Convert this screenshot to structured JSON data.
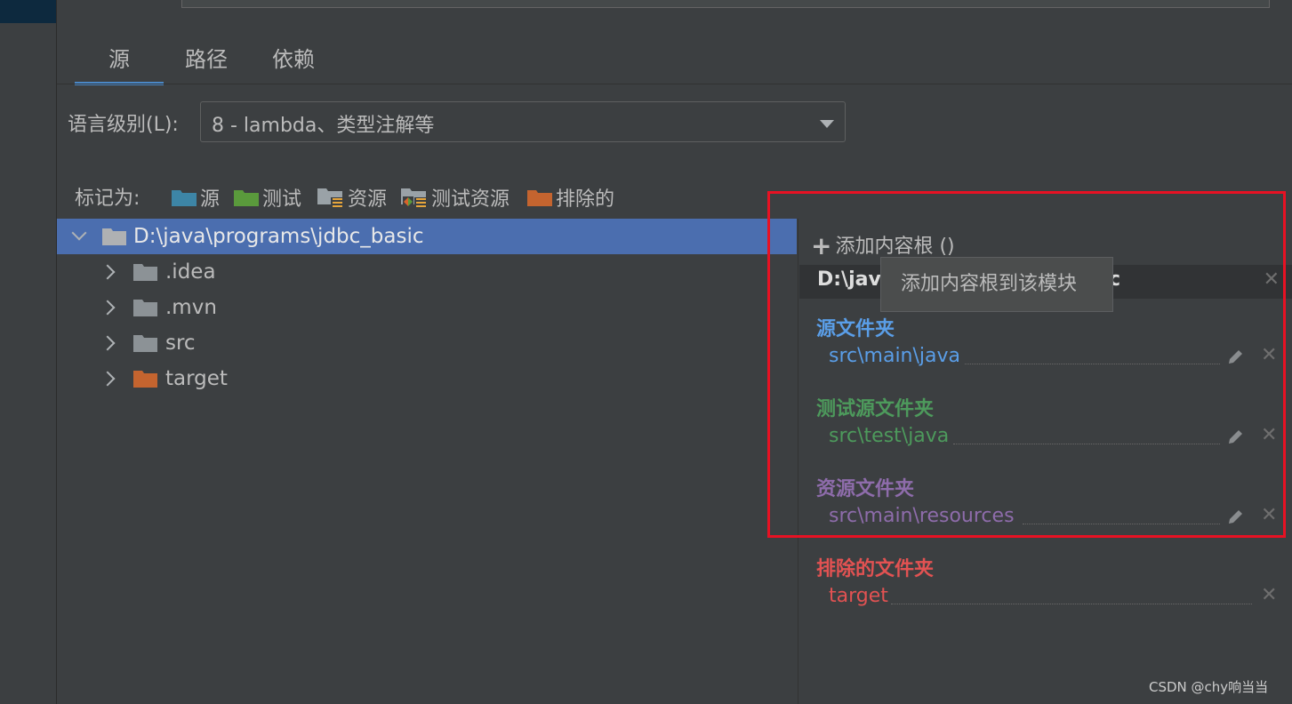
{
  "tabs": [
    {
      "label": "源",
      "active": true
    },
    {
      "label": "路径",
      "active": false
    },
    {
      "label": "依赖",
      "active": false
    }
  ],
  "language_level": {
    "label": "语言级别(L):",
    "value": "8 - lambda、类型注解等"
  },
  "mark_as": {
    "label": "标记为:",
    "items": [
      {
        "label": "源",
        "color": "#3d85a6"
      },
      {
        "label": "测试",
        "color": "#5a9a3c"
      },
      {
        "label": "资源",
        "color": "#9aa2a7"
      },
      {
        "label": "测试资源",
        "color": "#9aa2a7"
      },
      {
        "label": "排除的",
        "color": "#c4642f"
      }
    ]
  },
  "tree": {
    "root": {
      "label": "D:\\java\\programs\\jdbc_basic",
      "expanded": true,
      "selected": true
    },
    "children": [
      {
        "label": ".idea",
        "icon": "folder-icon"
      },
      {
        "label": ".mvn",
        "icon": "folder-icon"
      },
      {
        "label": "src",
        "icon": "folder-icon"
      },
      {
        "label": "target",
        "icon": "excluded-folder-icon"
      }
    ]
  },
  "content_root": {
    "add_label": "添加内容根 ()",
    "header_start": "D:\\jav",
    "header_end": "c",
    "tooltip": "添加内容根到该模块",
    "sections": [
      {
        "title": "源文件夹",
        "path": "src\\main\\java",
        "color": "#5a9ee8",
        "editable": true
      },
      {
        "title": "测试源文件夹",
        "path": "src\\test\\java",
        "color": "#4d9a5c",
        "editable": true
      },
      {
        "title": "资源文件夹",
        "path": "src\\main\\resources",
        "color": "#8e6cab",
        "editable": true
      },
      {
        "title": "排除的文件夹",
        "path": "target",
        "color": "#e25252",
        "editable": false
      }
    ]
  },
  "watermark": "CSDN @chy响当当"
}
